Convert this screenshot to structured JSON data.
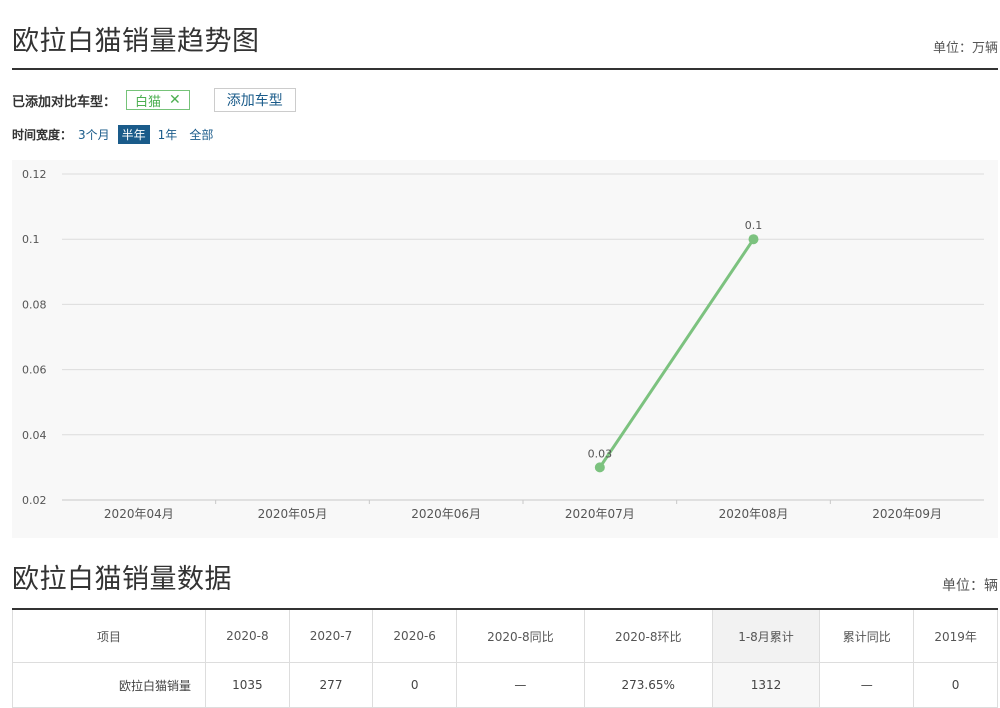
{
  "trend": {
    "title": "欧拉白猫销量趋势图",
    "unit": "单位：万辆"
  },
  "compare": {
    "label": "已添加对比车型：",
    "model_tag": "白猫",
    "add_button": "添加车型"
  },
  "range": {
    "label": "时间宽度：",
    "options": [
      "3个月",
      "半年",
      "1年",
      "全部"
    ],
    "selected": "半年"
  },
  "colors": {
    "series": "#7cc27f",
    "active": "#1a5b8a",
    "tag": "#4caf50"
  },
  "chart_data": {
    "type": "line",
    "categories": [
      "2020年04月",
      "2020年05月",
      "2020年06月",
      "2020年07月",
      "2020年08月",
      "2020年09月"
    ],
    "series": [
      {
        "values": [
          null,
          null,
          null,
          0.03,
          0.1,
          null
        ],
        "labels": [
          "",
          "",
          "",
          "0.03",
          "0.1",
          ""
        ]
      }
    ],
    "yticks": [
      "0.12",
      "0.1",
      "0.08",
      "0.06",
      "0.04",
      "0.02"
    ],
    "ylim": [
      0.02,
      0.12
    ],
    "grid": true
  },
  "table_section": {
    "title": "欧拉白猫销量数据",
    "unit": "单位：辆",
    "headers": [
      "项目",
      "2020-8",
      "2020-7",
      "2020-6",
      "2020-8同比",
      "2020-8环比",
      "1-8月累计",
      "累计同比",
      "2019年"
    ],
    "rows": [
      [
        "欧拉白猫销量",
        "1035",
        "277",
        "0",
        "—",
        "273.65%",
        "1312",
        "—",
        "0"
      ]
    ]
  }
}
